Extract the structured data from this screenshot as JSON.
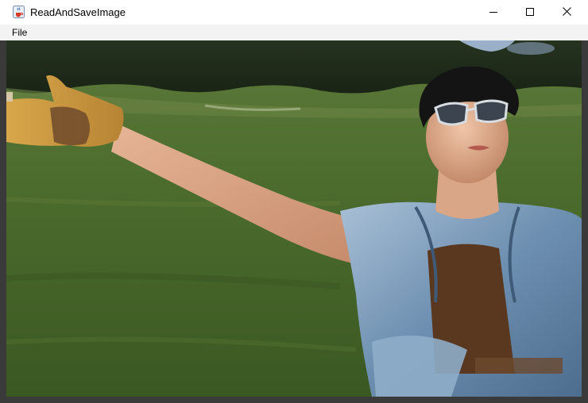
{
  "window": {
    "title": "ReadAndSaveImage",
    "app_icon": "java-cup-icon",
    "controls": {
      "minimize_icon": "minimize-icon",
      "maximize_icon": "maximize-icon",
      "close_icon": "close-icon"
    }
  },
  "menubar": {
    "items": [
      {
        "label": "File"
      }
    ]
  },
  "image": {
    "subject": "photo",
    "colors": {
      "grass": "#4a6b2c",
      "sky": "#8aa4c0",
      "trees": "#1f2a1c",
      "denim": "#7f9fbd",
      "glove": "#d9a845"
    }
  }
}
